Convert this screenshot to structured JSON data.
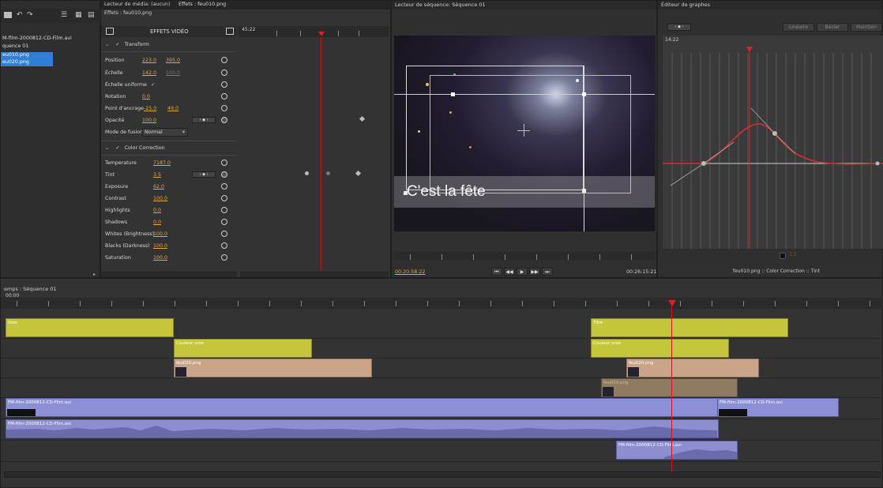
{
  "project_panel": {
    "items": [
      "M-film-2000812-CD-Film.avi",
      "quence 01",
      "eu010.png",
      "eu020.png"
    ]
  },
  "effects_panel": {
    "tab_media": "Lecteur de média: (aucun)",
    "tab_effects": "Effets : feu010.png",
    "subtitle": "Effets : feu010.png",
    "header_label": "EFFETS VIDÉO",
    "timecode": "45:22",
    "transform_label": "Transform",
    "position_label": "Position",
    "position_x": "223.0",
    "position_y": "395.0",
    "scale_label": "Échelle",
    "scale_x": "142.0",
    "scale_y": "100.0",
    "uniform_label": "Échelle uniforme",
    "uniform_check": "✓",
    "rotation_label": "Rotation",
    "rotation": "0.0",
    "anchor_label": "Point d'ancrage",
    "anchor_x": "-25.0",
    "anchor_y": "49.0",
    "opacity_label": "Opacité",
    "opacity": "100.0",
    "blend_label": "Mode de fusion",
    "blend_value": "Normal",
    "cc_label": "Color Correction",
    "temperature_label": "Temperature",
    "temperature": "7187.0",
    "tint_label": "Tint",
    "tint": "3.5",
    "exposure_label": "Exposure",
    "exposure": "62.0",
    "contrast_label": "Contrast",
    "contrast": "100.0",
    "highlights_label": "Highlights",
    "highlights": "0.0",
    "shadows_label": "Shadows",
    "shadows": "0.0",
    "whites_label": "Whites (Brightness)",
    "whites": "100.0",
    "blacks_label": "Blacks (Darkness)",
    "blacks": "100.0",
    "saturation_label": "Saturation",
    "saturation": "100.0"
  },
  "viewer": {
    "title": "Lecteur de séquence: Séquence 01",
    "overlay_text": "C'est la fête",
    "timecode_left": "00:20:58:22",
    "timecode_right": "00:26:15:21"
  },
  "graph_editor": {
    "title": "Éditeur de graphes",
    "btn_linear": "Linéaire",
    "btn_bezier": "Bézier",
    "btn_more": "Maintien",
    "timecode": "14:22",
    "value_readout": "3.5",
    "caption": "feu010.png :: Color Correction :: Tint"
  },
  "timeline": {
    "title": "emps : Séquence 01",
    "timecode": "00:00",
    "clips": {
      "titres": "itres",
      "titre": "Titre",
      "couleur1": "Couleur unie",
      "couleur2": "Couleur unie",
      "feu020a": "feu020.png",
      "feu020b": "feu020.png",
      "feu010": "feu010.png",
      "film1": "FM-film-2000812-CD-Film.avi",
      "film2": "FM-film-2000812-CD-Film.avi",
      "audio1": "FM-film-2000812-CD-Film.avi",
      "audio2": "FM-film-2000812-CD-Film.avi"
    }
  },
  "colors": {
    "accent_red": "#e02020",
    "keyframe_value": "#e5a93b",
    "clip_yellow": "#c6c63c",
    "clip_tan": "#c9a488",
    "clip_purple": "#8b8fd6"
  }
}
